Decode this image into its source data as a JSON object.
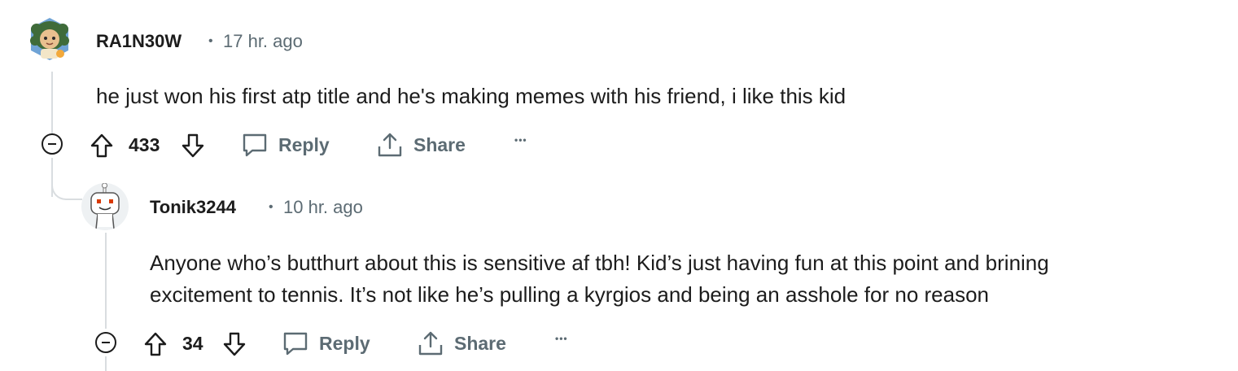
{
  "comments": [
    {
      "username": "RA1N30W",
      "separator": "•",
      "time": "17 hr. ago",
      "body": "he just won his first atp title and he's making memes with his friend, i like this kid",
      "score": "433",
      "reply_label": "Reply",
      "share_label": "Share",
      "more_label": "•••"
    },
    {
      "username": "Tonik3244",
      "separator": "•",
      "time": "10 hr. ago",
      "body_line1": "Anyone who’s butthurt about this is sensitive af tbh! Kid’s just having fun at this point and brining",
      "body_line2": "excitement to tennis. It’s not like he’s pulling a kyrgios and being an asshole for no reason",
      "score": "34",
      "reply_label": "Reply",
      "share_label": "Share",
      "more_label": "•••"
    }
  ],
  "colors": {
    "text": "#1c1c1c",
    "meta": "#5c6b73",
    "thread_line": "#d9dde0"
  }
}
